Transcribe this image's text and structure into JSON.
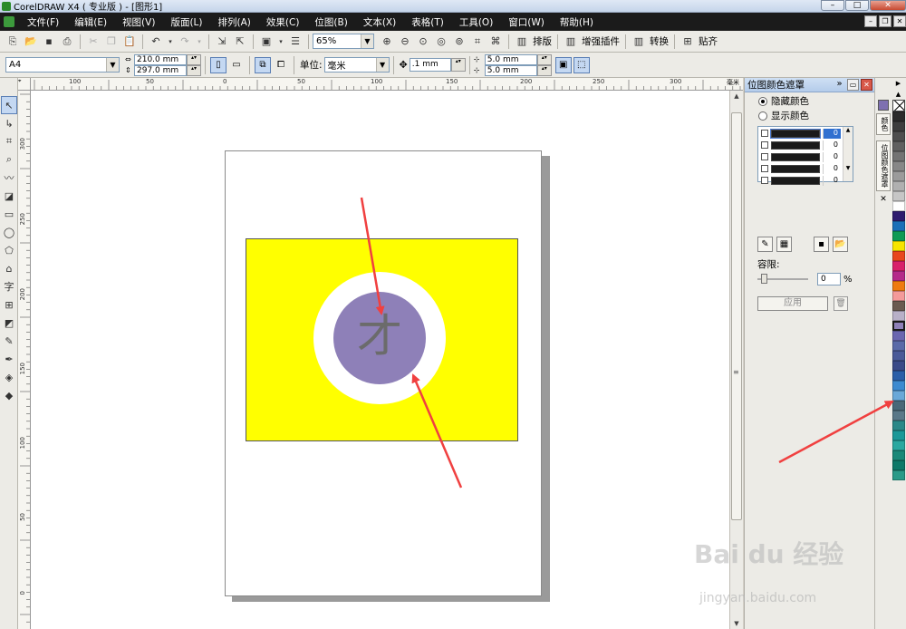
{
  "window": {
    "title": "CorelDRAW X4 ( 专业版 ) - [图形1]",
    "minimize": "–",
    "maximize": "□",
    "close": "✕"
  },
  "menu": [
    "文件(F)",
    "编辑(E)",
    "视图(V)",
    "版面(L)",
    "排列(A)",
    "效果(C)",
    "位图(B)",
    "文本(X)",
    "表格(T)",
    "工具(O)",
    "窗口(W)",
    "帮助(H)"
  ],
  "standard_toolbar": {
    "zoom": "65%",
    "plugins": [
      "排版",
      "增强插件",
      "转换",
      "贴齐"
    ]
  },
  "property_bar": {
    "paper_size": "A4",
    "width": "210.0 mm",
    "height": "297.0 mm",
    "units_label": "单位:",
    "units": "毫米",
    "nudge": ".1 mm",
    "dup_x": "5.0 mm",
    "dup_y": "5.0 mm"
  },
  "ruler": {
    "h_labels": [
      "100",
      "50",
      "0",
      "50",
      "100",
      "150",
      "200",
      "250",
      "300"
    ],
    "v_labels": [
      "300",
      "250",
      "200",
      "150",
      "100",
      "50",
      "0"
    ],
    "unit": "毫米"
  },
  "canvas": {
    "glyph": "才",
    "colors": {
      "rect": "#ffff00",
      "ring": "#ffffff",
      "circle": "#8e80b8",
      "arrow": "#f04040"
    }
  },
  "docker": {
    "title": "位图颜色遮罩",
    "hide_colors": "隐藏颜色",
    "show_colors": "显示颜色",
    "mask_rows": [
      {
        "value": "0"
      },
      {
        "value": "0"
      },
      {
        "value": "0"
      },
      {
        "value": "0"
      },
      {
        "value": "0"
      }
    ],
    "tolerance_label": "容限:",
    "tolerance_value": "0",
    "percent": "%",
    "apply_label": "应用"
  },
  "docker_tabs": [
    "颜色",
    "位图颜色遮罩"
  ],
  "palette": [
    "#2b2b2b",
    "#3d3d3d",
    "#4e4e4e",
    "#606060",
    "#737373",
    "#878787",
    "#9b9b9b",
    "#b0b0b0",
    "#c6c6c6",
    "#ffffff",
    "#2e1b6e",
    "#1a6fb8",
    "#0e9a55",
    "#f6e500",
    "#e8471d",
    "#d8206a",
    "#b52a8a",
    "#ef7b10",
    "#f49a9a",
    "#6a5a50",
    "#b8b0c8",
    "#8e80b8",
    "#6a66b0",
    "#5a6aa8",
    "#4a5a98",
    "#3a4a88",
    "#2a5ea8",
    "#3c8ad0",
    "#6aa8d8",
    "#4a6878",
    "#5a7888",
    "#2a8888",
    "#1a9898",
    "#2aa8a0",
    "#1a8878",
    "#0e7868",
    "#2a9a88"
  ],
  "watermark": {
    "main": "Bai du 经验",
    "sub": "jingyan.baidu.com"
  }
}
